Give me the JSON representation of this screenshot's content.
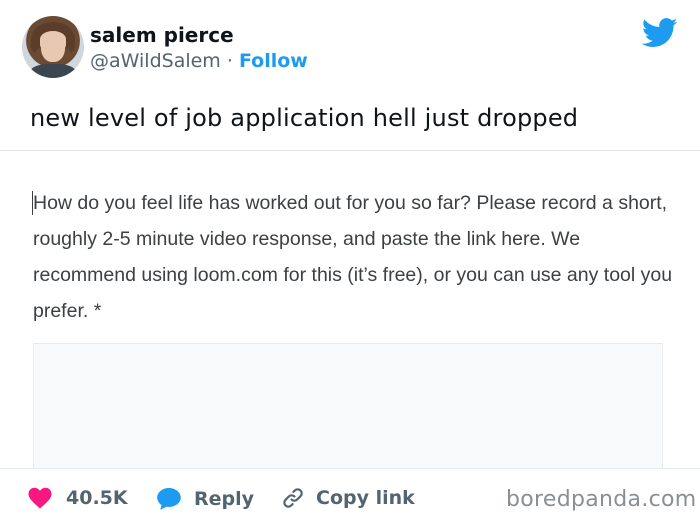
{
  "author": {
    "display_name": "salem pierce",
    "handle": "@aWildSalem",
    "separator": "·",
    "follow_label": "Follow"
  },
  "tweet": {
    "text": "new level of job application hell just dropped"
  },
  "media": {
    "question_text": "How do you feel life has worked out for you so far? Please record a short, roughly 2-5 minute video response, and paste the link here. We recommend using loom.com for this (it’s free), or you can use any tool you prefer. *"
  },
  "actions": {
    "like_count": "40.5K",
    "reply_label": "Reply",
    "copy_link_label": "Copy link"
  },
  "watermark": "boredpanda.com",
  "colors": {
    "accent": "#1d9bf0",
    "like": "#f91880",
    "text": "#0f1419",
    "muted": "#536471"
  },
  "icons": {
    "brand": "twitter-bird-icon",
    "like": "heart-icon",
    "reply": "reply-bubble-icon",
    "copy": "link-icon"
  }
}
